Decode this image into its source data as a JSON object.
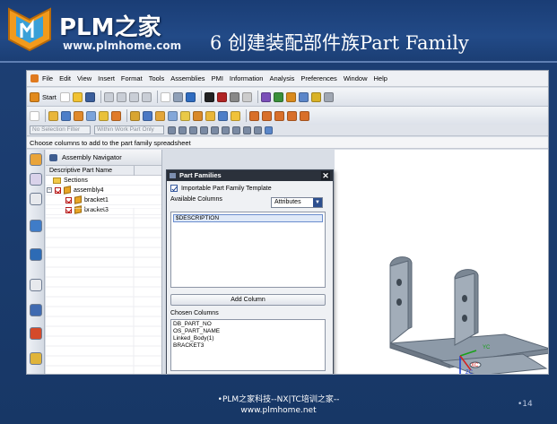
{
  "header": {
    "logo_text": "PLM之家",
    "logo_url": "www.plmhome.com",
    "slide_title": "6 创建装配部件族Part Family"
  },
  "nx": {
    "menubar": [
      "File",
      "Edit",
      "View",
      "Insert",
      "Format",
      "Tools",
      "Assemblies",
      "PMI",
      "Information",
      "Analysis",
      "Preferences",
      "Window",
      "Help"
    ],
    "start_label": "Start",
    "selection_filter": "No Selection Filter",
    "assembly_scope": "Within Work Part Only",
    "cue_line": "Choose columns to add to the part family spreadsheet"
  },
  "navigator": {
    "title": "Assembly Navigator",
    "column_header": "Descriptive Part Name",
    "items": [
      {
        "label": "Sections"
      },
      {
        "label": "assembly4"
      },
      {
        "label": "bracket1"
      },
      {
        "label": "bracket3"
      }
    ]
  },
  "part_families": {
    "title": "Part Families",
    "importable_template_label": "Importable Part Family Template",
    "importable_template_checked": true,
    "available_columns_label": "Available Columns",
    "column_type": "Attributes",
    "available_items": [
      "$DESCRIPTION"
    ],
    "add_column_label": "Add Column",
    "chosen_columns_label": "Chosen Columns",
    "chosen_items": [
      "DB_PART_NO",
      "OS_PART_NAME",
      "Linked_Body(1)",
      "BRACKET3"
    ]
  },
  "graphics": {
    "axis_labels": [
      "ZC",
      "YC",
      "XC"
    ]
  },
  "footer": {
    "line1": "•PLM之家科技--NX|TC培训之家--",
    "line2": "www.plmhome.net",
    "page_number": "•14"
  },
  "colors": {
    "slide_background": "#1d3f74",
    "dialog_title_bar": "#2b313b",
    "selection_highlight": "#dfe9f8",
    "part_model": "#8d9aa8"
  }
}
